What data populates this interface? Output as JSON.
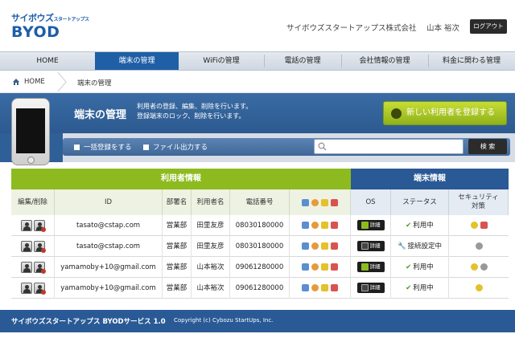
{
  "header": {
    "logo_top": "サイボウズ",
    "logo_top_small": "スタートアップス",
    "logo_bottom": "BYOD",
    "company": "サイボウズスタートアップス株式会社",
    "user": "山本 裕次",
    "logout": "ログアウト"
  },
  "nav": {
    "items": [
      {
        "label": "HOME"
      },
      {
        "label": "端末の管理",
        "active": true
      },
      {
        "label": "WiFiの管理"
      },
      {
        "label": "電話の管理"
      },
      {
        "label": "会社情報の管理"
      },
      {
        "label": "料金に関わる管理"
      }
    ]
  },
  "breadcrumb": {
    "home": "HOME",
    "current": "端末の管理"
  },
  "banner": {
    "title": "端末の管理",
    "desc1": "利用者の登録、編集、削除を行います。",
    "desc2": "登録端末のロック、削除を行います。",
    "register": "新しい利用者を登録する",
    "bulk": "一括登録をする",
    "fileout": "ファイル出力する",
    "search_placeholder": "",
    "search_button": "検 索"
  },
  "table": {
    "group_user": "利用者情報",
    "group_device": "端末情報",
    "headers": {
      "edit": "編集/削除",
      "id": "ID",
      "dept": "部署名",
      "name": "利用者名",
      "phone": "電話番号",
      "os": "OS",
      "status": "ステータス",
      "security1": "セキュリティ",
      "security2": "対策"
    },
    "rows": [
      {
        "id": "tasato@cstap.com",
        "dept": "営業部",
        "name": "田里友彦",
        "phone": "08030180000",
        "os": "Android",
        "os_label": "詳細",
        "status": "利用中",
        "status_ok": true
      },
      {
        "id": "tasato@cstap.com",
        "dept": "営業部",
        "name": "田里友彦",
        "phone": "08030180000",
        "os": "iOS",
        "os_label": "詳細",
        "status": "接続設定中",
        "status_ok": false
      },
      {
        "id": "yamamoby+10@gmail.com",
        "dept": "営業部",
        "name": "山本裕次",
        "phone": "09061280000",
        "os": "Android",
        "os_label": "詳細",
        "status": "利用中",
        "status_ok": true
      },
      {
        "id": "yamamoby+10@gmail.com",
        "dept": "営業部",
        "name": "山本裕次",
        "phone": "09061280000",
        "os": "iOS",
        "os_label": "詳細",
        "status": "利用中",
        "status_ok": true
      }
    ]
  },
  "footer": {
    "name": "サイボウズスタートアップス BYODサービス 1.0",
    "copyright": "Copyright (c) Cybozu StartUps, Inc."
  },
  "colors": {
    "brand_blue": "#2a5a96",
    "nav_active": "#1f5fa6",
    "accent_green": "#8dbb1f"
  }
}
